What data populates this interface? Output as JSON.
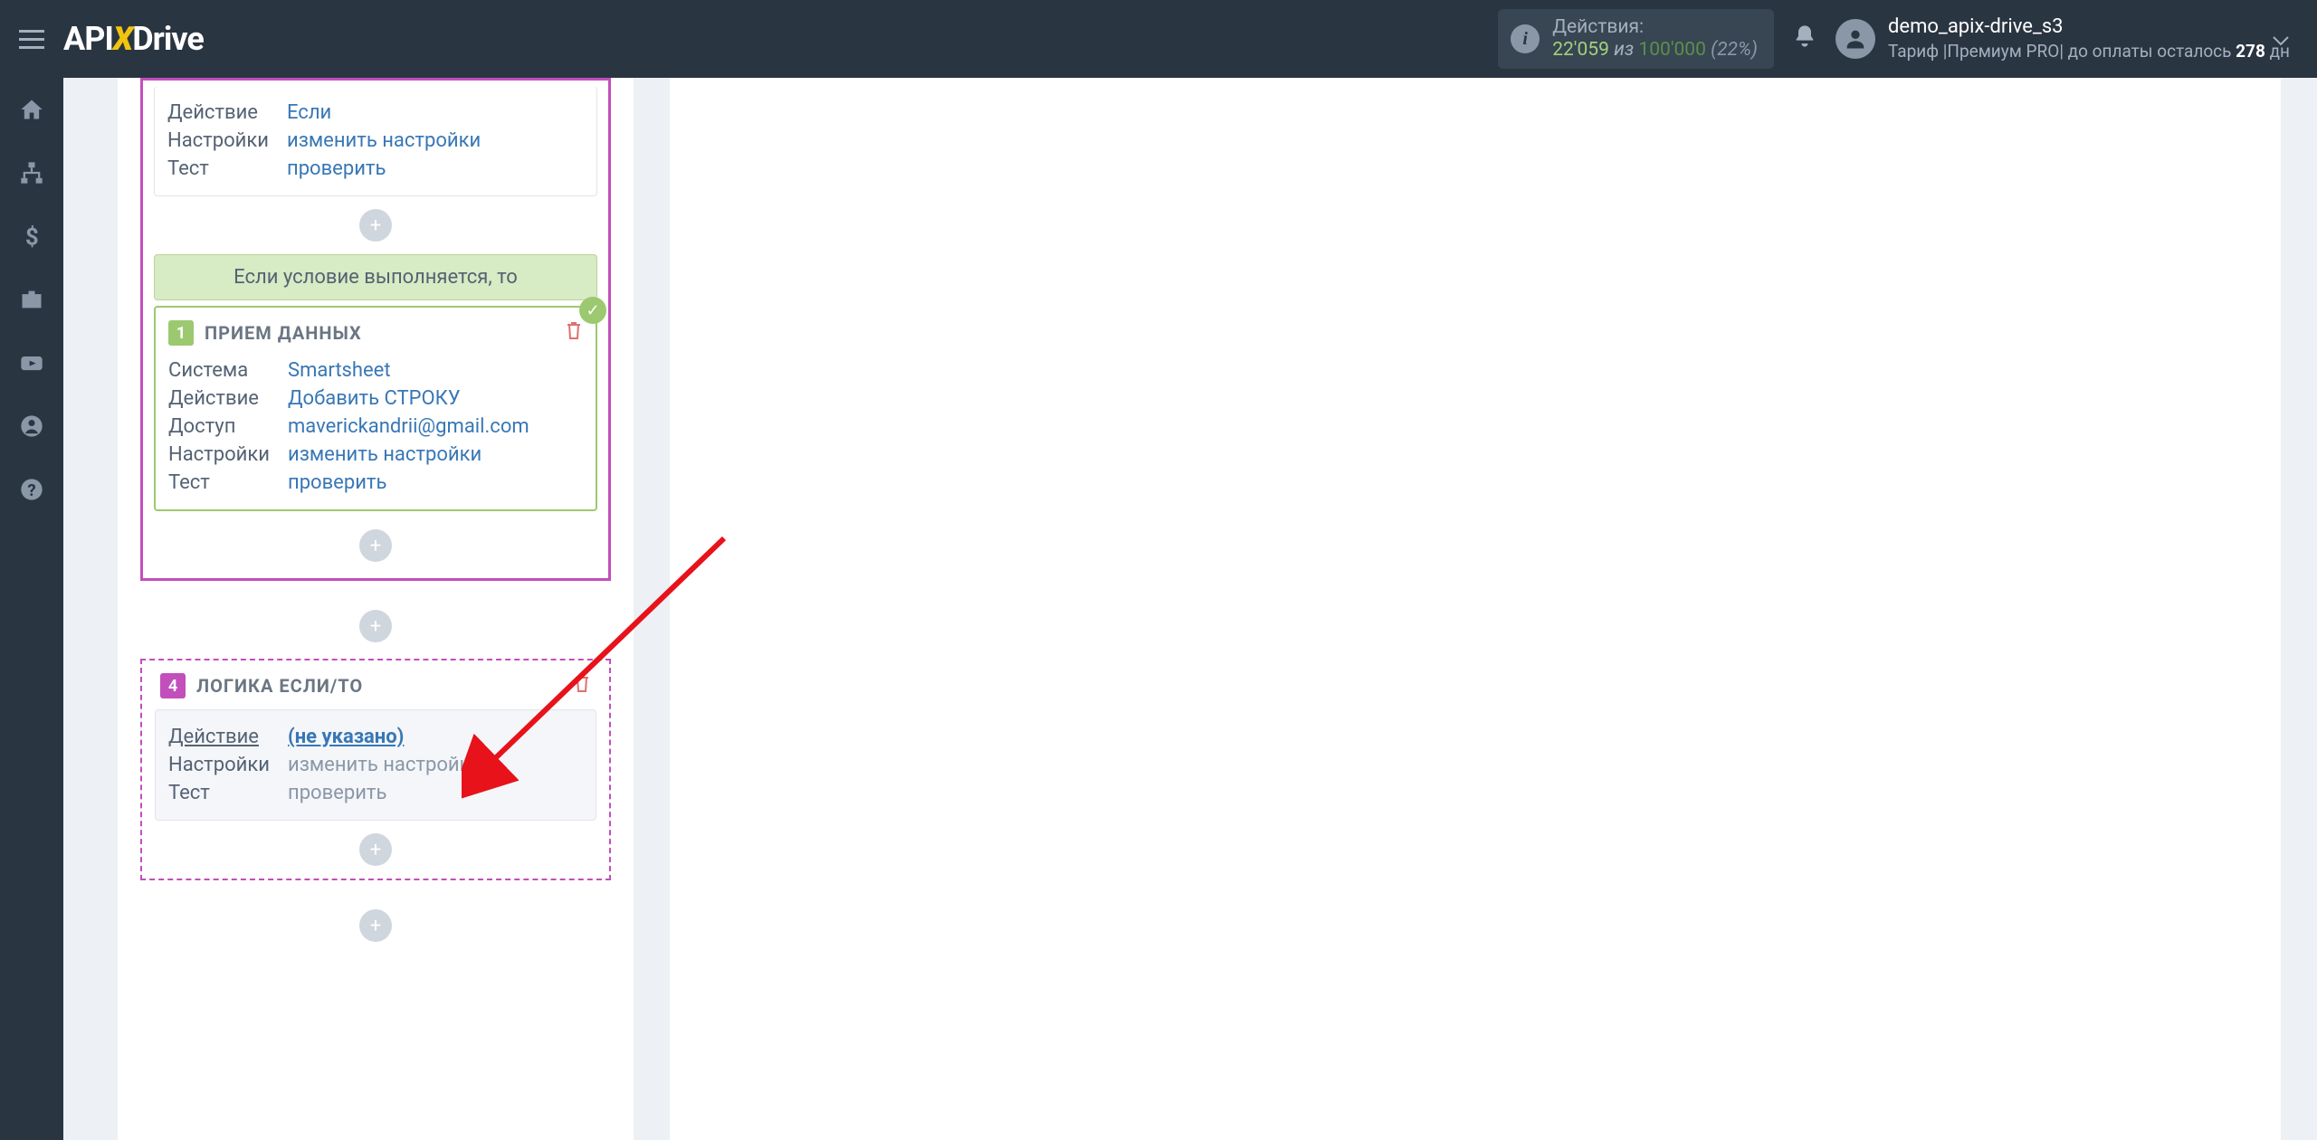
{
  "header": {
    "logo": {
      "pre": "API",
      "x": "X",
      "post": "Drive"
    },
    "actions": {
      "label": "Действия:",
      "current": "22'059",
      "of": "из",
      "max": "100'000",
      "percent": "(22%)"
    },
    "user": {
      "name": "demo_apix-drive_s3",
      "tariff_pre": "Тариф |Премиум PRO| до оплаты осталось ",
      "days": "278",
      "tariff_post": " дн"
    }
  },
  "card_top": {
    "rows": {
      "action": {
        "label": "Действие",
        "value": "Если"
      },
      "settings": {
        "label": "Настройки",
        "value": "изменить настройки"
      },
      "test": {
        "label": "Тест",
        "value": "проверить"
      }
    }
  },
  "condition_bar": "Если условие выполняется, то",
  "destination": {
    "step": "1",
    "title": "ПРИЕМ ДАННЫХ",
    "rows": {
      "system": {
        "label": "Система",
        "value": "Smartsheet"
      },
      "action": {
        "label": "Действие",
        "value": "Добавить СТРОКУ"
      },
      "access": {
        "label": "Доступ",
        "value": "maverickandrii@gmail.com"
      },
      "settings": {
        "label": "Настройки",
        "value": "изменить настройки"
      },
      "test": {
        "label": "Тест",
        "value": "проверить"
      }
    }
  },
  "logic": {
    "step": "4",
    "title": "ЛОГИКА ЕСЛИ/ТО",
    "rows": {
      "action": {
        "label": "Действие",
        "value": "(не указано)"
      },
      "settings": {
        "label": "Настройки",
        "value": "изменить настройки"
      },
      "test": {
        "label": "Тест",
        "value": "проверить"
      }
    }
  },
  "glyphs": {
    "plus": "+",
    "check": "✓",
    "info": "i",
    "bell": "🔔"
  }
}
